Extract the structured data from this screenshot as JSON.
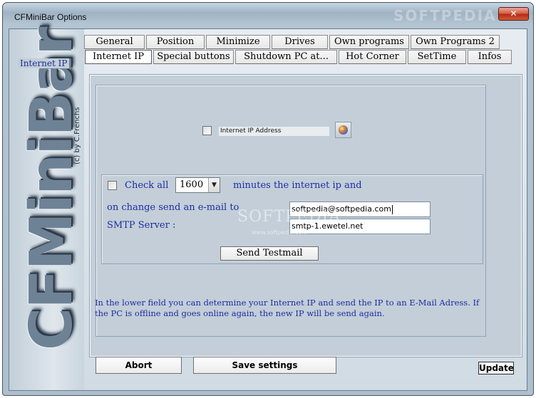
{
  "window": {
    "title": "CFMiniBar Options",
    "title_watermark": "SOFTPEDIA",
    "close_label": "✕"
  },
  "sidebar": {
    "logo": "CFMiniBar",
    "byline": "(c) by C.Frenchs"
  },
  "tabs": {
    "row1": [
      "General",
      "Position",
      "Minimize",
      "Drives",
      "Own programs",
      "Own Programs 2"
    ],
    "row2": [
      "Internet IP",
      "Special buttons",
      "Shutdown PC at...",
      "Hot Corner",
      "SetTime",
      "Infos"
    ],
    "active": "Internet IP"
  },
  "panel": {
    "group_title": "Internet IP",
    "ip_checkbox_checked": false,
    "ip_address_label": "Internet IP Address",
    "check_all_checked": false,
    "check_all_label": "Check all",
    "interval_value": "1600",
    "minutes_label": "minutes the internet ip and",
    "send_email_label": "on change send an e-mail to",
    "email_value": "softpedia@softpedia.com",
    "smtp_label": "SMTP Server :",
    "smtp_value": "smtp-1.ewetel.net",
    "testmail_label": "Send Testmail",
    "watermark": "SOFTPEDIA",
    "watermark_url": "www.softpedia.com",
    "info_text": "In the lower field you can determine your Internet IP and send the IP to an E-Mail Adress. If the PC is offline and goes online again, the new IP will be send again."
  },
  "buttons": {
    "abort": "Abort",
    "save": "Save settings",
    "update": "Update"
  }
}
